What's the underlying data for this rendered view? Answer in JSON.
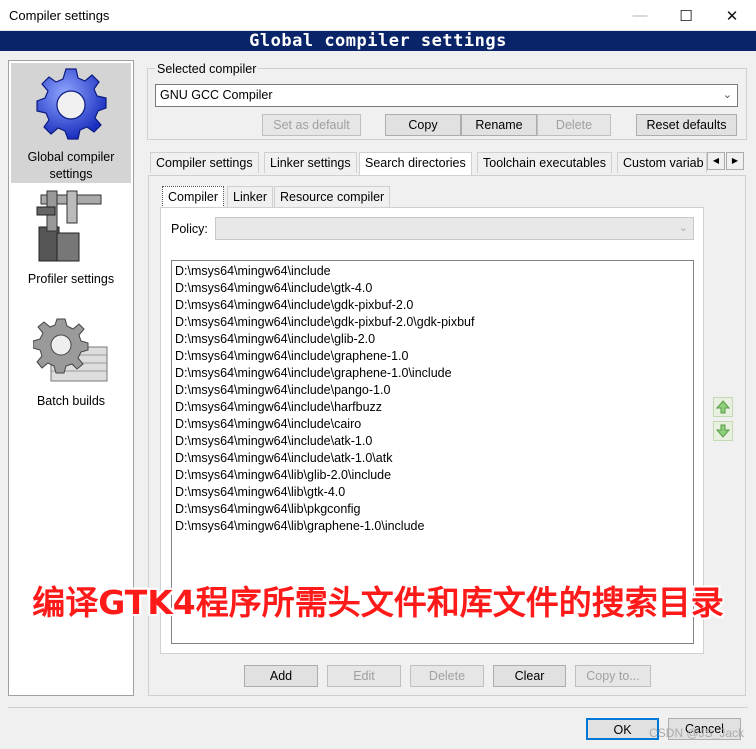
{
  "window": {
    "title": "Compiler settings",
    "banner": "Global compiler settings",
    "minimize": "—",
    "maximize": "☐",
    "close": "✕"
  },
  "sidebar": {
    "items": [
      {
        "label_line1": "Global compiler",
        "label_line2": "settings",
        "icon": "gear-icon",
        "selected": true
      },
      {
        "label_line1": "Profiler settings",
        "label_line2": "",
        "icon": "caliper-icon",
        "selected": false
      },
      {
        "label_line1": "Batch builds",
        "label_line2": "",
        "icon": "batch-gear-icon",
        "selected": false
      }
    ]
  },
  "selected_compiler": {
    "group_label": "Selected compiler",
    "value": "GNU GCC Compiler",
    "buttons": {
      "set_default": "Set as default",
      "copy": "Copy",
      "rename": "Rename",
      "delete": "Delete",
      "reset": "Reset defaults"
    }
  },
  "tabs": [
    "Compiler settings",
    "Linker settings",
    "Search directories",
    "Toolchain executables",
    "Custom variab"
  ],
  "active_tab": "Search directories",
  "subtabs": [
    "Compiler",
    "Linker",
    "Resource compiler"
  ],
  "active_subtab": "Compiler",
  "policy": {
    "label": "Policy:",
    "value": ""
  },
  "directories": [
    "D:\\msys64\\mingw64\\include",
    "D:\\msys64\\mingw64\\include\\gtk-4.0",
    "D:\\msys64\\mingw64\\include\\gdk-pixbuf-2.0",
    "D:\\msys64\\mingw64\\include\\gdk-pixbuf-2.0\\gdk-pixbuf",
    "D:\\msys64\\mingw64\\include\\glib-2.0",
    "D:\\msys64\\mingw64\\include\\graphene-1.0",
    "D:\\msys64\\mingw64\\include\\graphene-1.0\\include",
    "D:\\msys64\\mingw64\\include\\pango-1.0",
    "D:\\msys64\\mingw64\\include\\harfbuzz",
    "D:\\msys64\\mingw64\\include\\cairo",
    "D:\\msys64\\mingw64\\include\\atk-1.0",
    "D:\\msys64\\mingw64\\include\\atk-1.0\\atk",
    "D:\\msys64\\mingw64\\lib\\glib-2.0\\include",
    "D:\\msys64\\mingw64\\lib\\gtk-4.0",
    "D:\\msys64\\mingw64\\lib\\pkgconfig",
    "D:\\msys64\\mingw64\\lib\\graphene-1.0\\include"
  ],
  "dir_buttons": {
    "add": "Add",
    "edit": "Edit",
    "delete": "Delete",
    "clear": "Clear",
    "copy_to": "Copy to..."
  },
  "dialog_buttons": {
    "ok": "OK",
    "cancel": "Cancel"
  },
  "overlay_caption": "编译GTK4程序所需头文件和库文件的搜索目录",
  "watermark": "CSDN @JS_Jack",
  "colors": {
    "banner_bg": "#0a246a",
    "overlay_text": "#ff1a1a",
    "up_down_arrow": "#7fc46b"
  }
}
